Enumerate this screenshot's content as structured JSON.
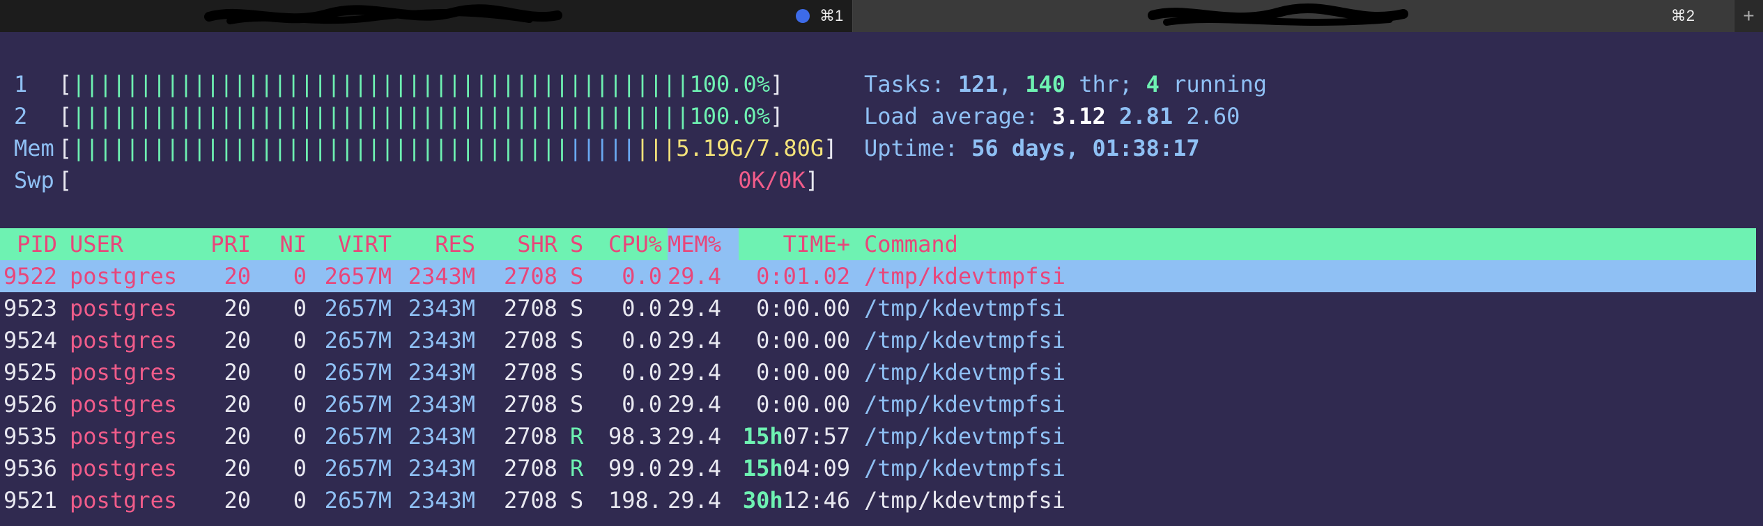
{
  "tabs": [
    {
      "title": "",
      "shortcut": "⌘1",
      "active": true
    },
    {
      "title": "",
      "shortcut": "⌘2",
      "active": false
    }
  ],
  "new_tab_label": "+",
  "meters": [
    {
      "label": "1",
      "bar": "||||||||||||||||||||||||||||||||||||||||||||||",
      "value": "100.0%"
    },
    {
      "label": "2",
      "bar": "||||||||||||||||||||||||||||||||||||||||||||||",
      "value": "100.0%"
    },
    {
      "label": "Mem",
      "bar_green": "|||||||||||||||||||||||||||||||||||||",
      "bar_blue": "|||||",
      "bar_yellow": "|||",
      "value": "5.19G/7.80G"
    },
    {
      "label": "Swp",
      "bar": "",
      "value": "0K/0K"
    }
  ],
  "info": {
    "tasks_label": "Tasks: ",
    "tasks": "121",
    "sep1": ", ",
    "threads": "140",
    "thr_label": " thr; ",
    "running": "4",
    "running_label": " running",
    "load_label": "Load average: ",
    "load1": "3.12",
    "load5": "2.81",
    "load15": "2.60",
    "uptime_label": "Uptime: ",
    "uptime": "56 days, 01:38:17"
  },
  "columns": {
    "pid": "PID",
    "user": "USER",
    "pri": "PRI",
    "ni": "NI",
    "virt": "VIRT",
    "res": "RES",
    "shr": "SHR",
    "s": "S",
    "cpu": "CPU%",
    "mem": "MEM%",
    "time": "TIME+",
    "cmd": "Command"
  },
  "processes": [
    {
      "pid": "9522",
      "user": "postgres",
      "pri": "20",
      "ni": "0",
      "virt": "2657M",
      "res": "2343M",
      "shr": "2708",
      "s": "S",
      "cpu": "0.0",
      "mem": "29.4",
      "time_h": "",
      "time": "0:01.02",
      "cmd": "/tmp/kdevtmpfsi"
    },
    {
      "pid": "9523",
      "user": "postgres",
      "pri": "20",
      "ni": "0",
      "virt": "2657M",
      "res": "2343M",
      "shr": "2708",
      "s": "S",
      "cpu": "0.0",
      "mem": "29.4",
      "time_h": "",
      "time": "0:00.00",
      "cmd": "/tmp/kdevtmpfsi"
    },
    {
      "pid": "9524",
      "user": "postgres",
      "pri": "20",
      "ni": "0",
      "virt": "2657M",
      "res": "2343M",
      "shr": "2708",
      "s": "S",
      "cpu": "0.0",
      "mem": "29.4",
      "time_h": "",
      "time": "0:00.00",
      "cmd": "/tmp/kdevtmpfsi"
    },
    {
      "pid": "9525",
      "user": "postgres",
      "pri": "20",
      "ni": "0",
      "virt": "2657M",
      "res": "2343M",
      "shr": "2708",
      "s": "S",
      "cpu": "0.0",
      "mem": "29.4",
      "time_h": "",
      "time": "0:00.00",
      "cmd": "/tmp/kdevtmpfsi"
    },
    {
      "pid": "9526",
      "user": "postgres",
      "pri": "20",
      "ni": "0",
      "virt": "2657M",
      "res": "2343M",
      "shr": "2708",
      "s": "S",
      "cpu": "0.0",
      "mem": "29.4",
      "time_h": "",
      "time": "0:00.00",
      "cmd": "/tmp/kdevtmpfsi"
    },
    {
      "pid": "9535",
      "user": "postgres",
      "pri": "20",
      "ni": "0",
      "virt": "2657M",
      "res": "2343M",
      "shr": "2708",
      "s": "R",
      "cpu": "98.3",
      "mem": "29.4",
      "time_h": "15h",
      "time": "07:57",
      "cmd": "/tmp/kdevtmpfsi"
    },
    {
      "pid": "9536",
      "user": "postgres",
      "pri": "20",
      "ni": "0",
      "virt": "2657M",
      "res": "2343M",
      "shr": "2708",
      "s": "R",
      "cpu": "99.0",
      "mem": "29.4",
      "time_h": "15h",
      "time": "04:09",
      "cmd": "/tmp/kdevtmpfsi"
    },
    {
      "pid": "9521",
      "user": "postgres",
      "pri": "20",
      "ni": "0",
      "virt": "2657M",
      "res": "2343M",
      "shr": "2708",
      "s": "S",
      "cpu": "198.",
      "mem": "29.4",
      "time_h": "30h",
      "time": "12:46",
      "cmd": "/tmp/kdevtmpfsi"
    }
  ],
  "colors": {
    "background": "#302a50",
    "header_bg": "#6ef2b2",
    "selected_bg": "#8fc0f4",
    "accent_pink": "#f05c8a",
    "accent_blue": "#8fc0f4",
    "accent_green": "#6ef2b2",
    "accent_yellow": "#f4e37a"
  }
}
